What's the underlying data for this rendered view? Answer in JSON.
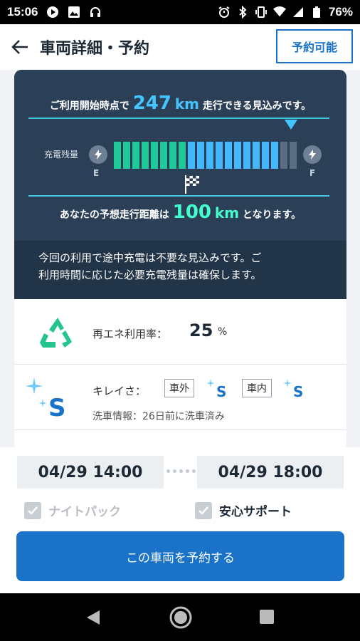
{
  "status_bar": {
    "time": "15:06",
    "battery_text": "76%",
    "icons": [
      "media-icon",
      "image-icon",
      "headset-icon",
      "alarm-icon",
      "bluetooth-icon",
      "vibrate-icon",
      "wifi-icon",
      "signal-icon",
      "battery-icon"
    ]
  },
  "header": {
    "title": "車両詳細・予約",
    "status_button": "予約可能"
  },
  "range": {
    "prefix": "ご利用開始時点で",
    "value": "247",
    "unit": "km",
    "suffix": "走行できる見込みです。",
    "charge_label": "充電残量",
    "empty_label": "E",
    "full_label": "F",
    "charge_level_fraction": 0.92,
    "needed_level_fraction": 0.38,
    "est_prefix": "あなたの予想走行距離は",
    "est_value": "100",
    "est_unit": "km",
    "est_suffix": "となります。"
  },
  "note": {
    "line1": "今回の利用で途中充電は不要な見込みです。ご",
    "line2": "利用時間に応じた必要充電残量は確保します。"
  },
  "renewable": {
    "label": "再エネ利用率：",
    "value": "25",
    "unit": "%"
  },
  "cleanliness": {
    "label": "キレイさ：",
    "exterior_label": "車外",
    "exterior_grade": "S",
    "interior_label": "車内",
    "interior_grade": "S",
    "big_grade": "S",
    "wash_info": "洗車情報：26日前に洗車済み"
  },
  "booking": {
    "start": "04/29 14:00",
    "end": "04/29 18:00",
    "night_pack_label": "ナイトパック",
    "support_label": "安心サポート",
    "reserve_button": "この車両を予約する"
  },
  "colors": {
    "accent": "#1a73c9",
    "dark_panel": "#2b3f57",
    "range_blue": "#43c6ff",
    "est_green": "#43ffcc",
    "bar_green": "#1ec99a",
    "bar_blue": "#43b8ff"
  }
}
